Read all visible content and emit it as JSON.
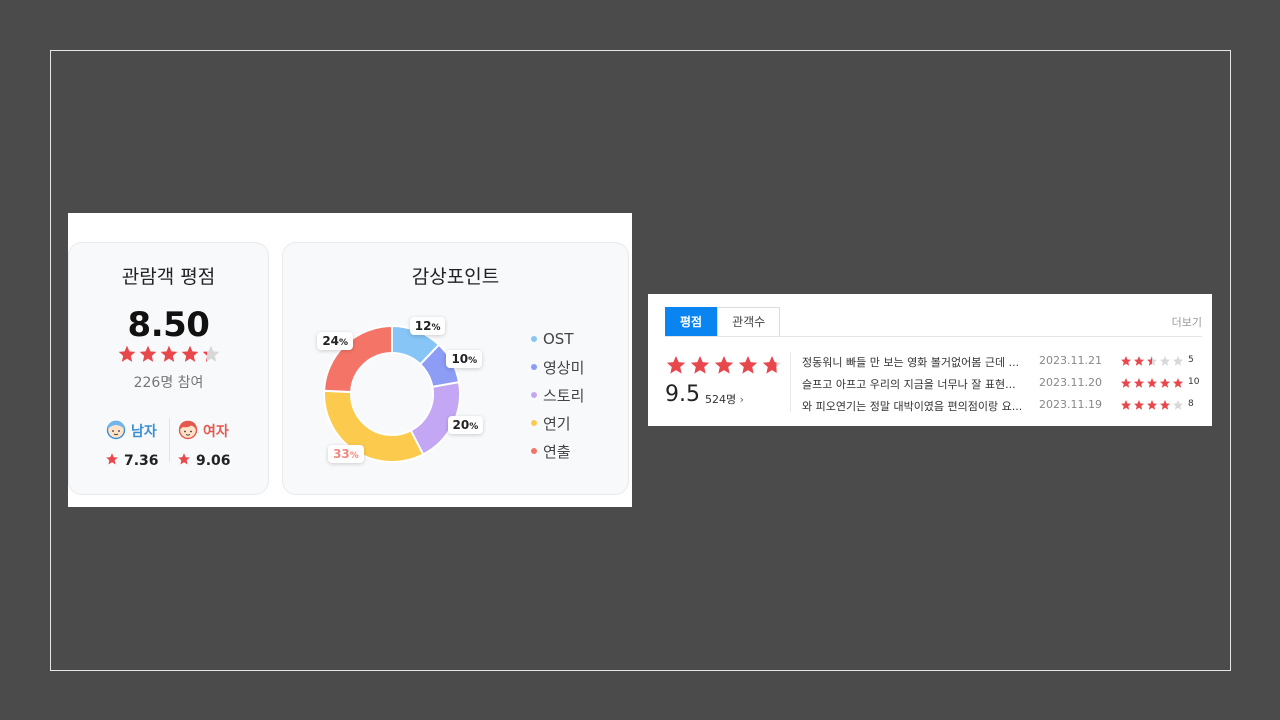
{
  "rating_card": {
    "title": "관람객 평점",
    "score": "8.50",
    "star_rating": 4.25,
    "participants": "226명 참여",
    "male": {
      "label": "남자",
      "score": "7.36"
    },
    "female": {
      "label": "여자",
      "score": "9.06"
    }
  },
  "point_card": {
    "title": "감상포인트",
    "segments": [
      {
        "name": "OST",
        "percent": 12,
        "label": "12",
        "color": "#86c5f6"
      },
      {
        "name": "영상미",
        "percent": 10,
        "label": "10",
        "color": "#8d9cf5"
      },
      {
        "name": "스토리",
        "percent": 20,
        "label": "20",
        "color": "#c3a7f4"
      },
      {
        "name": "연기",
        "percent": 33,
        "label": "33",
        "color": "#fccb4e"
      },
      {
        "name": "연출",
        "percent": 24,
        "label": "24",
        "color": "#f47567"
      }
    ],
    "percent_sign": "%"
  },
  "review_panel": {
    "tabs": [
      {
        "label": "평점"
      },
      {
        "label": "관객수"
      }
    ],
    "more_label": "더보기",
    "summary": {
      "score": "9.5",
      "count": "524명",
      "chevron": "›",
      "star_rating": 4.75
    },
    "reviews": [
      {
        "text": "정동워니 빠들 만 보는 영화 볼거없어봄 근데 ...",
        "date": "2023.11.21",
        "rating": 2.5,
        "score": "5"
      },
      {
        "text": "슬프고 아프고 우리의 지금을 너무나 잘 표현...",
        "date": "2023.11.20",
        "rating": 5,
        "score": "10"
      },
      {
        "text": "와 피오연기는 정말 대박이였음 편의점이랑 요...",
        "date": "2023.11.19",
        "rating": 4,
        "score": "8"
      }
    ]
  },
  "colors": {
    "star_active": "#e8474c",
    "star_inactive": "#d8d8d8",
    "tab_active": "#0a84f0",
    "male": "#3a8fd6",
    "female": "#e5584e"
  }
}
